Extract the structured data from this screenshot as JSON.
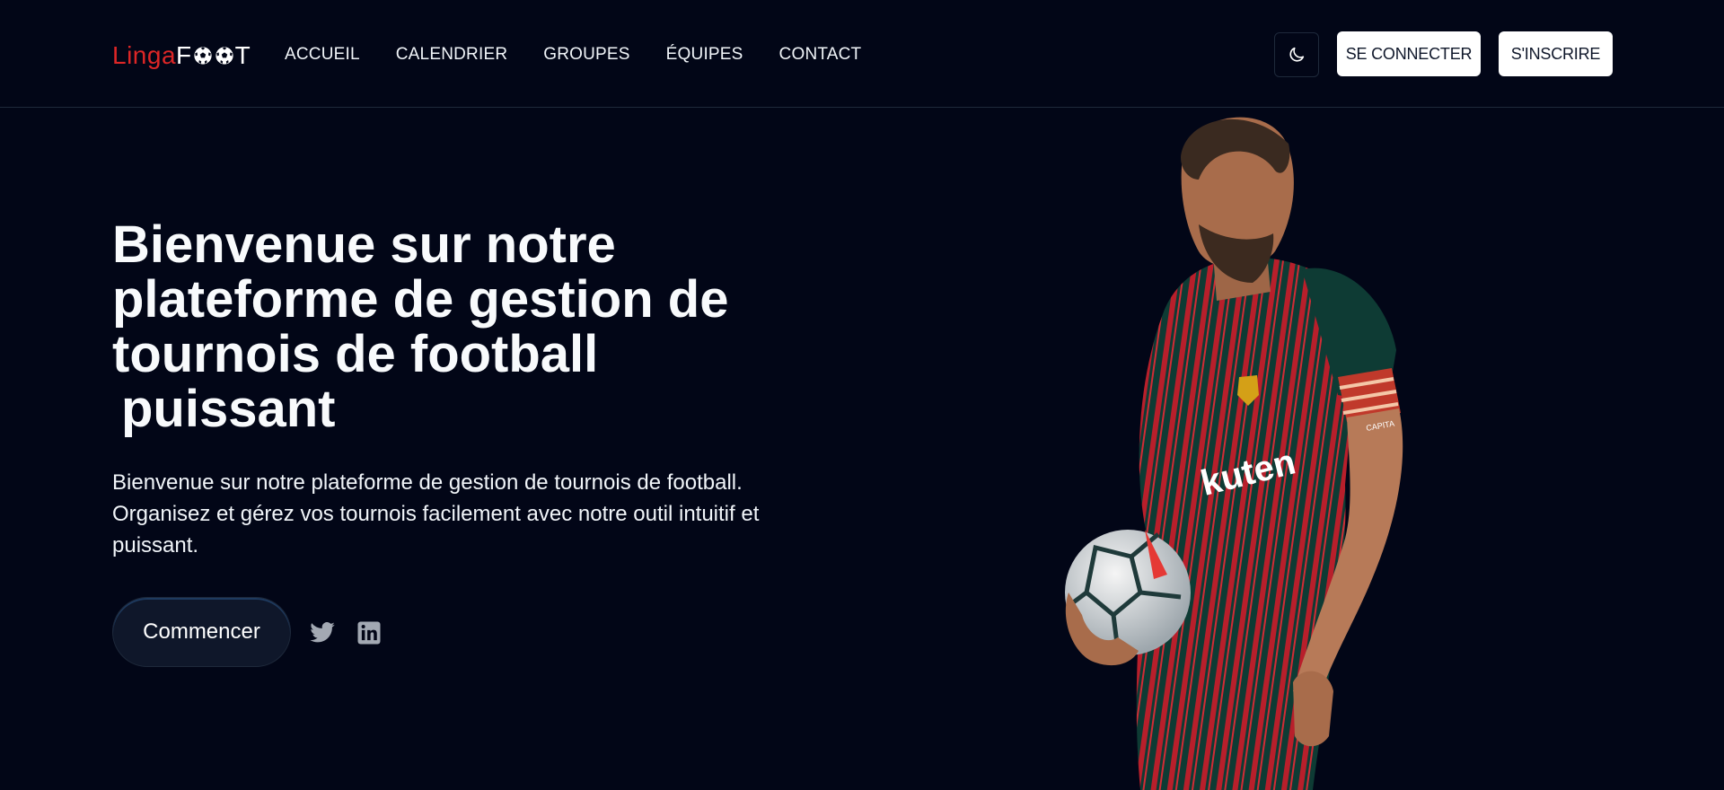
{
  "logo": {
    "part1": "Linga",
    "part2": "F",
    "part3": "T"
  },
  "nav": {
    "items": [
      {
        "label": "ACCUEIL"
      },
      {
        "label": "CALENDRIER"
      },
      {
        "label": "GROUPES"
      },
      {
        "label": "ÉQUIPES"
      },
      {
        "label": "CONTACT"
      }
    ]
  },
  "header": {
    "theme_icon": "moon-icon",
    "login_label": "SE CONNECTER",
    "signup_label": "S'INSCRIRE"
  },
  "hero": {
    "title_lines": [
      "Bienvenue sur notre",
      "plateforme de gestion de",
      "tournois de football",
      "puissant"
    ],
    "description": "Bienvenue sur notre plateforme de gestion de tournois de football. Organisez et gérez vos tournois facilement avec notre outil intuitif et puissant.",
    "cta_label": "Commencer",
    "social_icons": [
      "twitter-icon",
      "linkedin-icon"
    ],
    "image_text": [
      "kuten",
      "CAPITA"
    ]
  },
  "colors": {
    "background": "#020617",
    "accent_red": "#dc2626",
    "text": "#f8fafc"
  }
}
